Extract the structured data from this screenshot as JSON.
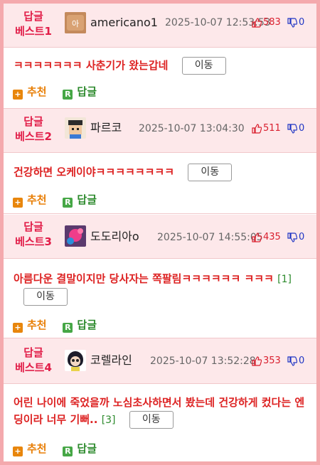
{
  "best_prefix": "답글",
  "actions": {
    "recommend": "추천",
    "reply": "답글",
    "move": "이동",
    "plus_glyph": "+",
    "r_glyph": "R"
  },
  "comments": [
    {
      "rank": "베스트1",
      "nickname": "americano1",
      "date": "2025-10-07 12:53:53",
      "up": "583",
      "down": "0",
      "text": "ㅋㅋㅋㅋㅋㅋㅋ 사춘기가 왔는갑네",
      "reply_count": ""
    },
    {
      "rank": "베스트2",
      "nickname": "파르코",
      "date": "2025-10-07 13:04:30",
      "up": "511",
      "down": "0",
      "text": "건강하면 오케이야ㅋㅋㅋㅋㅋㅋㅋㅋ",
      "reply_count": ""
    },
    {
      "rank": "베스트3",
      "nickname": "도도리아o",
      "date": "2025-10-07 14:55:05",
      "up": "435",
      "down": "0",
      "text": "아름다운 결말이지만 당사자는 쪽팔림ㅋㅋㅋㅋㅋㅋ ㅋㅋㅋ",
      "reply_count": "[1]"
    },
    {
      "rank": "베스트4",
      "nickname": "코렐라인",
      "date": "2025-10-07 13:52:28",
      "up": "353",
      "down": "0",
      "text": "어린 나이에 죽었을까 노심초사하면서 봤는데 건강하게 컸다는 엔딩이라 너무 기뻐..",
      "reply_count": "[3]"
    }
  ],
  "colors": {
    "frame": "#f4a9ad",
    "header_bg": "#fde8ea",
    "best": "#e11d48",
    "body_text": "#dd2222",
    "recommend": "#e87f07",
    "reply": "#2d8a2d",
    "up": "#d91f2e",
    "down": "#1f35c4"
  }
}
